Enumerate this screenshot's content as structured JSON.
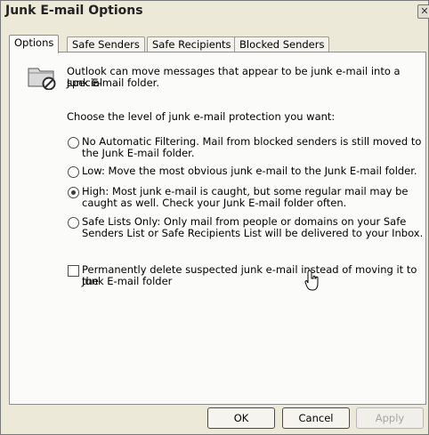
{
  "window": {
    "title": "Junk E-mail Options",
    "close_glyph": "✕"
  },
  "tabs": [
    {
      "label": "Options",
      "active": true
    },
    {
      "label": "Safe Senders",
      "active": false
    },
    {
      "label": "Safe Recipients",
      "active": false
    },
    {
      "label": "Blocked Senders",
      "active": false
    }
  ],
  "intro": {
    "icon": "junk-folder-icon",
    "line1": "Outlook can move messages that appear to be junk e-mail into a special",
    "line2": "Junk E-mail folder."
  },
  "prompt": "Choose the level of junk e-mail protection you want:",
  "levels": [
    {
      "line1": "No Automatic Filtering.  Mail from blocked senders is still moved to",
      "line2": "the Junk E-mail folder.",
      "selected": false
    },
    {
      "line1": "Low: Move the most obvious junk e-mail to the Junk E-mail folder.",
      "line2": "",
      "selected": false
    },
    {
      "line1": "High: Most junk e-mail is caught, but some regular mail may be",
      "line2": "caught as well. Check your Junk E-mail folder often.",
      "selected": true
    },
    {
      "line1": "Safe Lists Only: Only mail from people or domains on your Safe",
      "line2": "Senders List or Safe Recipients List will be delivered to your Inbox.",
      "selected": false
    }
  ],
  "delete_option": {
    "line1": "Permanently delete suspected junk e-mail instead of moving it to the",
    "line2": "Junk E-mail folder",
    "checked": false
  },
  "buttons": {
    "ok": "OK",
    "cancel": "Cancel",
    "apply": "Apply"
  }
}
